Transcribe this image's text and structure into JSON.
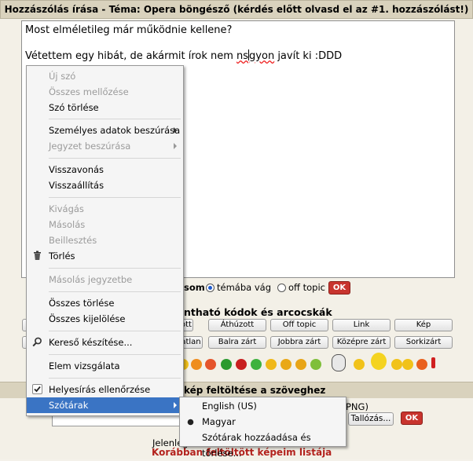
{
  "title": "Hozzászólás írása - Téma: Opera böngésző (kérdés előtt olvasd el az #1. hozzászólást!)",
  "editor": {
    "line1": "Most elméletileg már működnie kellene?",
    "line2_before": "Vétettem egy hibát, de akármit írok nem ",
    "misspelled_word_a": "ns",
    "misspelled_word_b": "gyon",
    "line2_after": " javít ki :DDD"
  },
  "form": {
    "option_label_fragment": "som",
    "radio_topic_label": "témába vág",
    "radio_offtopic_label": "off topic",
    "ok_label": "OK",
    "codes_heading_fragment": "ntható kódok és arcocskák",
    "row1": [
      "ott",
      "Áthúzott",
      "Off topic",
      "Link",
      "Kép"
    ],
    "row2": [
      "atlan",
      "Balra zárt",
      "Jobbra zárt",
      "Középre zárt",
      "Sorkizárt"
    ],
    "upload_heading_fragment": "kép feltöltése a szöveghez",
    "filetype_fragment": "PNG)",
    "browse_label": "Tallózás...",
    "upload_ok_label": "OK",
    "current_fragment": "Jelenleg re",
    "previous_images_link": "Korábban feltöltött képeim listája"
  },
  "context_menu": {
    "items": [
      {
        "label": "Új szó",
        "disabled": true
      },
      {
        "label": "Összes mellőzése",
        "disabled": true
      },
      {
        "label": "Szó törlése",
        "disabled": false
      },
      {
        "label": "Személyes adatok beszúrása",
        "disabled": false,
        "submenu": true
      },
      {
        "label": "Jegyzet beszúrása",
        "disabled": true,
        "submenu": true
      },
      {
        "label": "Visszavonás",
        "disabled": false
      },
      {
        "label": "Visszaállítás",
        "disabled": false
      },
      {
        "label": "Kivágás",
        "disabled": true
      },
      {
        "label": "Másolás",
        "disabled": true
      },
      {
        "label": "Beillesztés",
        "disabled": true
      },
      {
        "label": "Törlés",
        "disabled": false,
        "icon": "trash-icon"
      },
      {
        "label": "Másolás jegyzetbe",
        "disabled": true
      },
      {
        "label": "Összes törlése",
        "disabled": false
      },
      {
        "label": "Összes kijelölése",
        "disabled": false
      },
      {
        "label": "Kereső készítése...",
        "disabled": false,
        "icon": "search-icon"
      },
      {
        "label": "Elem vizsgálata",
        "disabled": false
      },
      {
        "label": "Helyesírás ellenőrzése",
        "disabled": false,
        "icon": "checkbox-checked-icon"
      },
      {
        "label": "Szótárak",
        "disabled": false,
        "submenu": true,
        "highlighted": true
      }
    ]
  },
  "dictionaries_submenu": {
    "items": [
      {
        "label": "English (US)",
        "selected": false
      },
      {
        "label": "Magyar",
        "selected": true
      },
      {
        "label": "Szótárak hozzáadása és törlése...",
        "selected": false
      }
    ]
  },
  "colors": {
    "highlight": "#3a74c4",
    "ok_button": "#c8342e",
    "link": "#b3221d",
    "header_bar": "#d9d2bd"
  }
}
